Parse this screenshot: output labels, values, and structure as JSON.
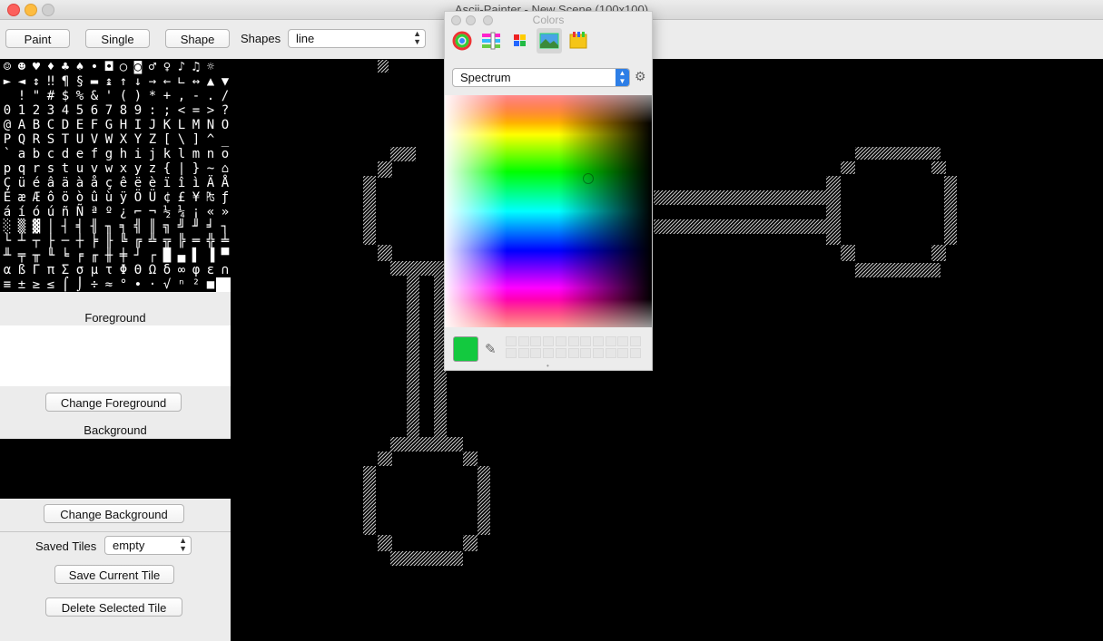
{
  "window": {
    "title": "Ascii-Painter - New Scene (100x100)"
  },
  "toolbar": {
    "paint_label": "Paint",
    "single_label": "Single",
    "shape_label": "Shape",
    "shapes_label": "Shapes",
    "shapes_value": "line"
  },
  "glyph_palette": {
    "rows": [
      "☺☻♥♦♣♠•◘○◙♂♀♪♫☼",
      "►◄↕‼¶§▬↨↑↓→←∟↔▲▼",
      " !\"#$%&'()*+,-./",
      "0123456789:;<=>?",
      "@ABCDEFGHIJKLMNO",
      "PQRSTUVWXYZ[\\]^_",
      "`abcdefghijklmno",
      "pqrstuvwxyz{|}~⌂",
      "ÇüéâäàåçêëèïîìÄÅ",
      "ÉæÆôöòûùÿÖÜ¢£¥₧ƒ",
      "áíóúñÑªº¿⌐¬½¼¡«»",
      "░▒▓│┤╡╢╖╕╣║╗╝╜╛┐",
      "└┴┬├─┼╞╟╚╔╩╦╠═╬╧",
      "╨╤╥╙╘╒╓╫╪┘┌█▄▌▐▀",
      "αßΓπΣσµτΦΘΩδ∞φε∩",
      "≡±≥≤⌠⌡÷≈°∙·√ⁿ²■ "
    ]
  },
  "left_panel": {
    "foreground_label": "Foreground",
    "change_foreground_label": "Change Foreground",
    "background_label": "Background",
    "change_background_label": "Change Background",
    "saved_tiles_label": "Saved Tiles",
    "saved_tiles_value": "empty",
    "save_tile_label": "Save Current Tile",
    "delete_tile_label": "Delete Selected Tile"
  },
  "colors_panel": {
    "title": "Colors",
    "mode_value": "Spectrum",
    "current_color": "#13c93f",
    "tabs": [
      "color-wheel-icon",
      "color-sliders-icon",
      "color-palettes-icon",
      "image-palettes-icon",
      "crayons-icon"
    ]
  },
  "colors": {
    "foreground": "#ffffff",
    "background": "#000000",
    "canvas_bg": "#000000",
    "accent": "#13c93f"
  }
}
